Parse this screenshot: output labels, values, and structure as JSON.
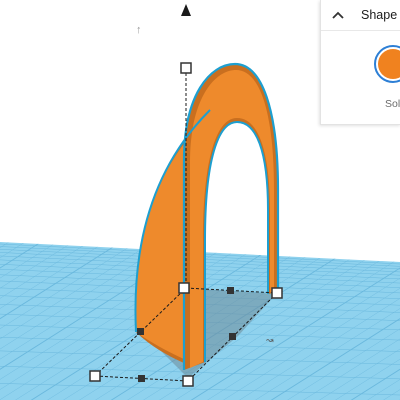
{
  "viewport": {
    "workplane_color": "#8fd2ee",
    "workplane_line_color": "#6ab8dd",
    "shape_color": "#ee8a2c",
    "shape_dark_color": "#c96f1f",
    "selection_outline_color": "#1d9fd0"
  },
  "shape_panel": {
    "title": "Shape",
    "collapse_icon": "chevron-up-icon",
    "solid_label": "Solid",
    "solid_color": "#f0821f"
  }
}
